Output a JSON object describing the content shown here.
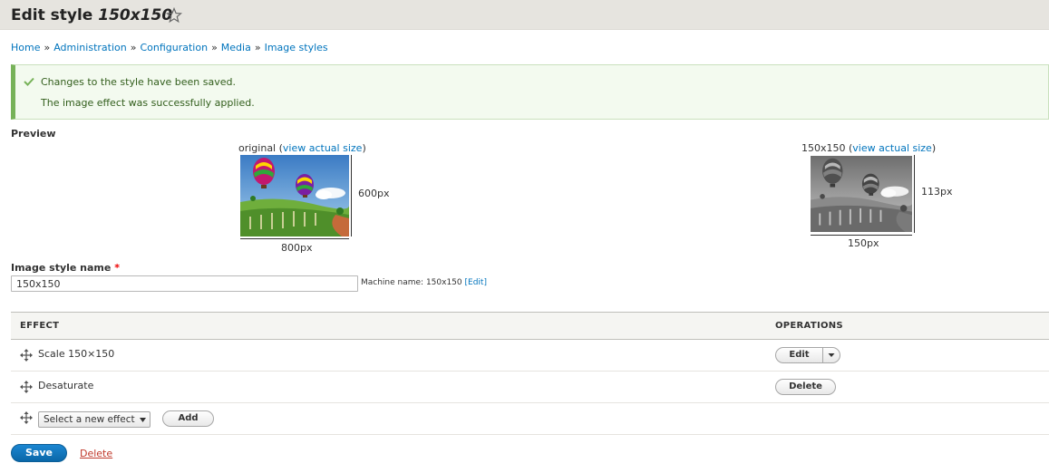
{
  "header": {
    "title_prefix": "Edit style",
    "title_name": "150x150"
  },
  "breadcrumb": [
    {
      "label": "Home"
    },
    {
      "label": "Administration"
    },
    {
      "label": "Configuration"
    },
    {
      "label": "Media"
    },
    {
      "label": "Image styles"
    }
  ],
  "breadcrumb_separator": "»",
  "messages": [
    "Changes to the style have been saved.",
    "The image effect was successfully applied."
  ],
  "preview": {
    "label": "Preview",
    "original": {
      "caption_prefix": "original (",
      "link": "view actual size",
      "caption_suffix": ")",
      "height_label": "600px",
      "width_label": "800px"
    },
    "derivative": {
      "caption_prefix": "150x150 (",
      "link": "view actual size",
      "caption_suffix": ")",
      "height_label": "113px",
      "width_label": "150px"
    }
  },
  "name_field": {
    "label": "Image style name",
    "required_mark": "*",
    "value": "150x150",
    "machine_prefix": "Machine name: 150x150",
    "machine_edit": "[Edit]"
  },
  "table": {
    "col_effect": "EFFECT",
    "col_operations": "OPERATIONS",
    "rows": [
      {
        "effect": "Scale 150×150",
        "op": "Edit"
      },
      {
        "effect": "Desaturate",
        "op": "Delete"
      }
    ],
    "new_effect_select": "Select a new effect",
    "add_label": "Add"
  },
  "actions": {
    "save": "Save",
    "delete": "Delete"
  },
  "colors": {
    "link": "#0074bd",
    "save_button": "#0a67a8",
    "status_border": "#77b259",
    "delete_link": "#c0392b"
  },
  "icons": {
    "favorite": "star-icon",
    "status": "check-icon",
    "drag": "move-icon",
    "dropdown": "chevron-down-icon"
  }
}
